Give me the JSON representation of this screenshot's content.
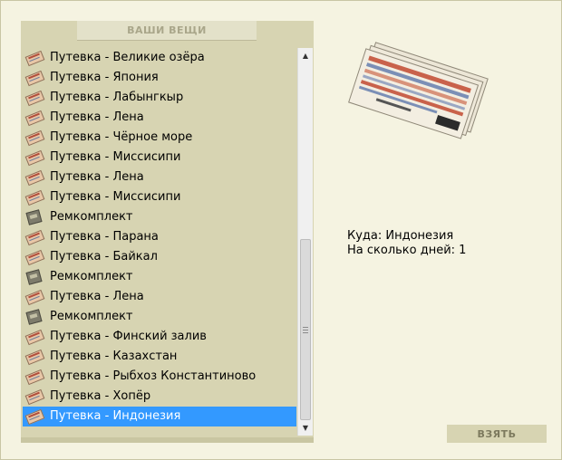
{
  "panel": {
    "title": "ВАШИ ВЕЩИ"
  },
  "items": [
    {
      "label": "Путевка - Великие озёра",
      "icon": "ticket-icon"
    },
    {
      "label": "Путевка - Япония",
      "icon": "ticket-icon"
    },
    {
      "label": "Путевка - Лабынгкыр",
      "icon": "ticket-icon"
    },
    {
      "label": "Путевка - Лена",
      "icon": "ticket-icon"
    },
    {
      "label": "Путевка - Чёрное море",
      "icon": "ticket-icon"
    },
    {
      "label": "Путевка - Миссисипи",
      "icon": "ticket-icon"
    },
    {
      "label": "Путевка - Лена",
      "icon": "ticket-icon"
    },
    {
      "label": "Путевка - Миссисипи",
      "icon": "ticket-icon"
    },
    {
      "label": "Ремкомплект",
      "icon": "repair-kit-icon"
    },
    {
      "label": "Путевка - Парана",
      "icon": "ticket-icon"
    },
    {
      "label": "Путевка - Байкал",
      "icon": "ticket-icon"
    },
    {
      "label": "Ремкомплект",
      "icon": "repair-kit-icon"
    },
    {
      "label": "Путевка - Лена",
      "icon": "ticket-icon"
    },
    {
      "label": "Ремкомплект",
      "icon": "repair-kit-icon"
    },
    {
      "label": "Путевка - Финский залив",
      "icon": "ticket-icon"
    },
    {
      "label": "Путевка - Казахстан",
      "icon": "ticket-icon"
    },
    {
      "label": "Путевка - Рыбхоз Константиново",
      "icon": "ticket-icon"
    },
    {
      "label": "Путевка - Хопёр",
      "icon": "ticket-icon"
    },
    {
      "label": "Путевка - Индонезия",
      "icon": "ticket-icon",
      "selected": true
    }
  ],
  "details": {
    "destination": "Куда: Индонезия",
    "days": "На сколько дней: 1"
  },
  "actions": {
    "take_label": "ВЗЯТЬ"
  },
  "colors": {
    "background": "#f5f3e1",
    "panel": "#d7d4b2",
    "selection": "#3399ff"
  }
}
